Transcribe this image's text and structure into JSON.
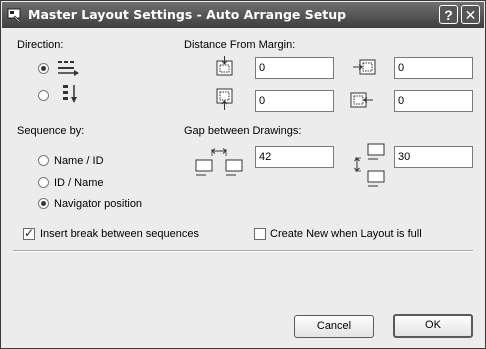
{
  "window": {
    "title": "Master Layout Settings - Auto Arrange Setup",
    "help_glyph": "?",
    "close_glyph": "✕"
  },
  "direction": {
    "label": "Direction:",
    "options": [
      {
        "icon": "horizontal-arrange-icon",
        "selected": true
      },
      {
        "icon": "vertical-arrange-icon",
        "selected": false
      }
    ]
  },
  "distance_from_margin": {
    "label": "Distance From Margin:",
    "top": "0",
    "right": "0",
    "bottom": "0",
    "left": "0"
  },
  "sequence_by": {
    "label": "Sequence by:",
    "options": [
      {
        "label": "Name / ID",
        "selected": false
      },
      {
        "label": "ID / Name",
        "selected": false
      },
      {
        "label": "Navigator position",
        "selected": true
      }
    ]
  },
  "gap_between_drawings": {
    "label": "Gap between Drawings:",
    "horizontal": "42",
    "vertical": "30"
  },
  "options": {
    "insert_break": {
      "label": "Insert break between sequences",
      "checked": true
    },
    "create_new": {
      "label": "Create New when Layout is full",
      "checked": false
    }
  },
  "buttons": {
    "cancel": "Cancel",
    "ok": "OK"
  }
}
